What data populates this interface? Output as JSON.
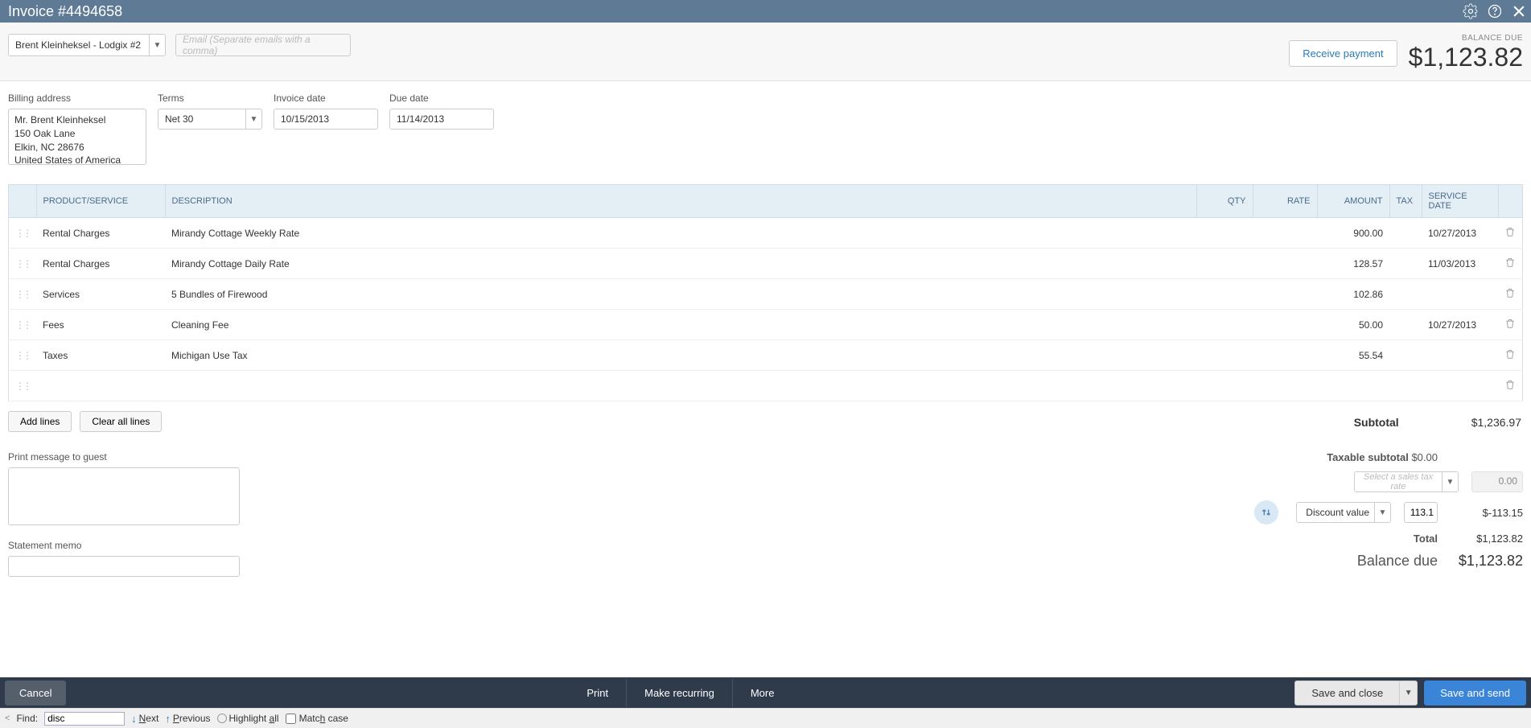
{
  "titlebar": {
    "title": "Invoice #4494658"
  },
  "header": {
    "customer": "Brent Kleinheksel - Lodgix #2",
    "email_placeholder": "Email (Separate emails with a comma)",
    "receive_payment": "Receive payment",
    "balance_due_label": "BALANCE DUE",
    "balance_due_amount": "$1,123.82"
  },
  "fields": {
    "billing_label": "Billing address",
    "billing_line1": "Mr. Brent Kleinheksel",
    "billing_line2": "150 Oak Lane",
    "billing_line3": "Elkin, NC  28676",
    "billing_line4": "United States of America",
    "terms_label": "Terms",
    "terms_value": "Net 30",
    "invoice_date_label": "Invoice date",
    "invoice_date_value": "10/15/2013",
    "due_date_label": "Due date",
    "due_date_value": "11/14/2013"
  },
  "columns": {
    "product": "PRODUCT/SERVICE",
    "description": "DESCRIPTION",
    "qty": "QTY",
    "rate": "RATE",
    "amount": "AMOUNT",
    "tax": "TAX",
    "service_date": "SERVICE DATE"
  },
  "lines": [
    {
      "product": "Rental Charges",
      "description": "Mirandy Cottage Weekly Rate",
      "amount": "900.00",
      "service_date": "10/27/2013"
    },
    {
      "product": "Rental Charges",
      "description": "Mirandy Cottage Daily Rate",
      "amount": "128.57",
      "service_date": "11/03/2013"
    },
    {
      "product": "Services",
      "description": "5 Bundles of Firewood",
      "amount": "102.86",
      "service_date": ""
    },
    {
      "product": "Fees",
      "description": "Cleaning Fee",
      "amount": "50.00",
      "service_date": "10/27/2013"
    },
    {
      "product": "Taxes",
      "description": "Michigan Use Tax",
      "amount": "55.54",
      "service_date": ""
    }
  ],
  "buttons": {
    "add_lines": "Add lines",
    "clear_all": "Clear all lines"
  },
  "totals": {
    "subtotal_label": "Subtotal",
    "subtotal_value": "$1,236.97",
    "taxable_subtotal_label": "Taxable subtotal",
    "taxable_subtotal_value": "$0.00",
    "tax_rate_placeholder": "Select a sales tax rate",
    "tax_val": "0.00",
    "discount_label": "Discount value",
    "discount_input": "113.1",
    "discount_value": "$-113.15",
    "total_label": "Total",
    "total_value": "$1,123.82",
    "balance_due_label": "Balance due",
    "balance_due_value": "$1,123.82"
  },
  "memo": {
    "print_label": "Print message to guest",
    "statement_label": "Statement memo"
  },
  "footer": {
    "cancel": "Cancel",
    "print": "Print",
    "make_recurring": "Make recurring",
    "more": "More",
    "save_close": "Save and close",
    "save_send": "Save and send"
  },
  "find": {
    "label": "Find:",
    "value": "disc",
    "next": "Next",
    "previous": "Previous",
    "highlight": "Highlight all",
    "match_case": "Match case"
  }
}
